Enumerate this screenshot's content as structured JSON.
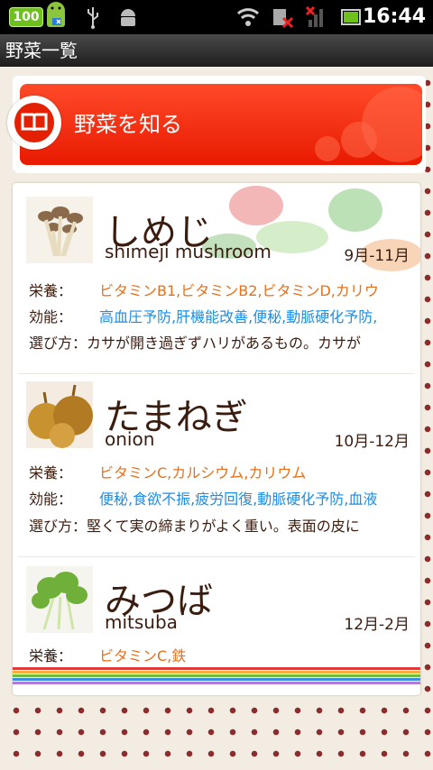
{
  "status_bar": {
    "battery_badge": "100",
    "time": "16:44",
    "colors": {
      "battery": "#6ec01c",
      "background": "#000000"
    }
  },
  "title_bar": {
    "title": "野菜一覧"
  },
  "banner": {
    "label": "野菜を知る",
    "color": "#e81a00"
  },
  "list": {
    "labels": {
      "nutrition": "栄養：",
      "effect": "効能：",
      "how_to_choose": "選び方："
    },
    "items": [
      {
        "name_jp": "しめじ",
        "name_en": "shimeji mushroom",
        "season": "9月-11月",
        "nutrition": "ビタミンB1,ビタミンB2,ビタミンD,カリウ",
        "effect": "高血圧予防,肝機能改善,便秘,動脈硬化予防,",
        "how_to_choose": "カサが開き過ぎずハリがあるもの。カサが"
      },
      {
        "name_jp": "たまねぎ",
        "name_en": "onion",
        "season": "10月-12月",
        "nutrition": "ビタミンC,カルシウム,カリウム",
        "effect": "便秘,食欲不振,疲労回復,動脈硬化予防,血液",
        "how_to_choose": "堅くて実の締まりがよく重い。表面の皮に"
      },
      {
        "name_jp": "みつば",
        "name_en": "mitsuba",
        "season": "12月-2月",
        "nutrition": "ビタミンC,鉄"
      }
    ],
    "colors": {
      "nutrition": "#e8701a",
      "effect": "#1a8ee8",
      "text": "#3b1d10"
    }
  },
  "icons": [
    "battery-badge-icon",
    "android-robot-icon",
    "usb-icon",
    "android-debug-icon",
    "wifi-icon",
    "sync-error-icon",
    "signal-icon",
    "battery-icon",
    "book-icon"
  ]
}
